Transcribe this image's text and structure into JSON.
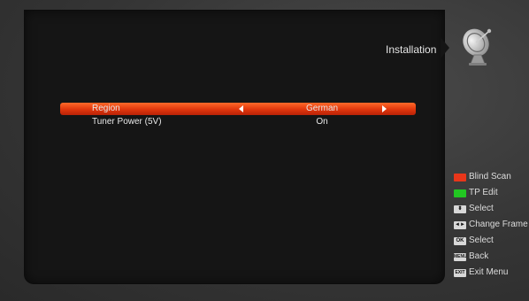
{
  "header": {
    "title": "Installation",
    "icon": "satellite-dish-icon"
  },
  "menu": {
    "rows": [
      {
        "label": "Region",
        "value": "German",
        "selected": true
      },
      {
        "label": "Tuner Power (5V)",
        "value": "On",
        "selected": false
      }
    ]
  },
  "legend": {
    "items": [
      {
        "key": "red",
        "color": "#e8361a",
        "label": "Blind Scan"
      },
      {
        "key": "green",
        "color": "#22c622",
        "label": "TP Edit"
      },
      {
        "key": "up-down-button",
        "glyph": "⬍",
        "label": "Select"
      },
      {
        "key": "left-right-button",
        "glyph": "◄►",
        "label": "Change Frame"
      },
      {
        "key": "ok-button",
        "glyph": "OK",
        "label": "Select"
      },
      {
        "key": "menu-button",
        "glyph": "MENU",
        "label": "Back"
      },
      {
        "key": "exit-button",
        "glyph": "EXIT",
        "label": "Exit Menu"
      }
    ]
  },
  "colors": {
    "accent": "#e0360c",
    "panel": "#151515",
    "background": "#3a3a3a"
  }
}
